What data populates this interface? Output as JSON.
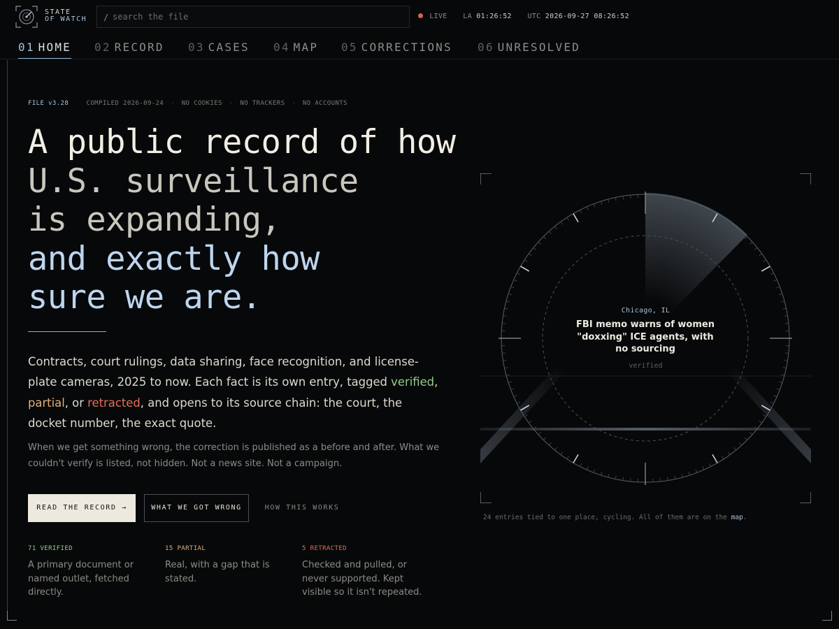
{
  "brand": {
    "line1": "STATE",
    "line2": "OF WATCH"
  },
  "search": {
    "slash": "/",
    "placeholder": "search the file"
  },
  "status": {
    "live": "LIVE",
    "la_label": "LA",
    "la_time": "01:26:52",
    "utc_label": "UTC",
    "utc_time": "2026-09-27 08:26:52",
    "live_color": "#e0604c"
  },
  "nav": [
    {
      "num": "01",
      "label": "HOME",
      "active": true
    },
    {
      "num": "02",
      "label": "RECORD"
    },
    {
      "num": "03",
      "label": "CASES"
    },
    {
      "num": "04",
      "label": "MAP"
    },
    {
      "num": "05",
      "label": "CORRECTIONS"
    },
    {
      "num": "06",
      "label": "UNRESOLVED"
    }
  ],
  "meta": {
    "file": "FILE v3.28",
    "compiled": "COMPILED 2026-09-24",
    "cookies": "NO COOKIES",
    "trackers": "NO TRACKERS",
    "accounts": "NO ACCOUNTS"
  },
  "headline": {
    "line1": "A public record of how",
    "line2": "U.S. surveillance",
    "line3": "is expanding,",
    "line4": "and exactly how",
    "line5": "sure we are."
  },
  "lead": {
    "p1": "Contracts, court rulings, data sharing, face recognition, and license-plate cameras, 2025 to now. Each fact is its own entry, tagged ",
    "verified": "verified",
    "p2": ", ",
    "partial": "partial",
    "p3": ", or ",
    "retracted": "retracted",
    "p4": ", and opens to its source chain: the court, the docket number, the exact quote."
  },
  "sub": "When we get something wrong, the correction is published as a before and after. What we couldn't verify is listed, not hidden. Not a news site. Not a campaign.",
  "buttons": {
    "read": "READ THE RECORD →",
    "wrong": "WHAT WE GOT WRONG",
    "how": "HOW THIS WORKS"
  },
  "stats": [
    {
      "label": "71 VERIFIED",
      "desc": "A primary document or named outlet, fetched directly."
    },
    {
      "label": "15 PARTIAL",
      "desc": "Real, with a gap that is stated."
    },
    {
      "label": "5 RETRACTED",
      "desc": "Checked and pulled, or never supported. Kept visible so it isn't repeated."
    }
  ],
  "radar": {
    "place": "Chicago, IL",
    "title": "FBI memo warns of women \"doxxing\" ICE agents, with no sourcing",
    "status": "verified"
  },
  "caption": {
    "text": "24 entries tied to one place, cycling. All of them are on the ",
    "link": "map",
    "end": "."
  },
  "colors": {
    "accent": "#8fb2d6",
    "verified": "#8fcf86",
    "partial": "#e1ae77",
    "retracted": "#e66c58",
    "background": "#070809"
  },
  "icons": {
    "logo": "radar-logo-icon",
    "live": "live-dot-icon",
    "arrow": "arrow-right-icon"
  }
}
